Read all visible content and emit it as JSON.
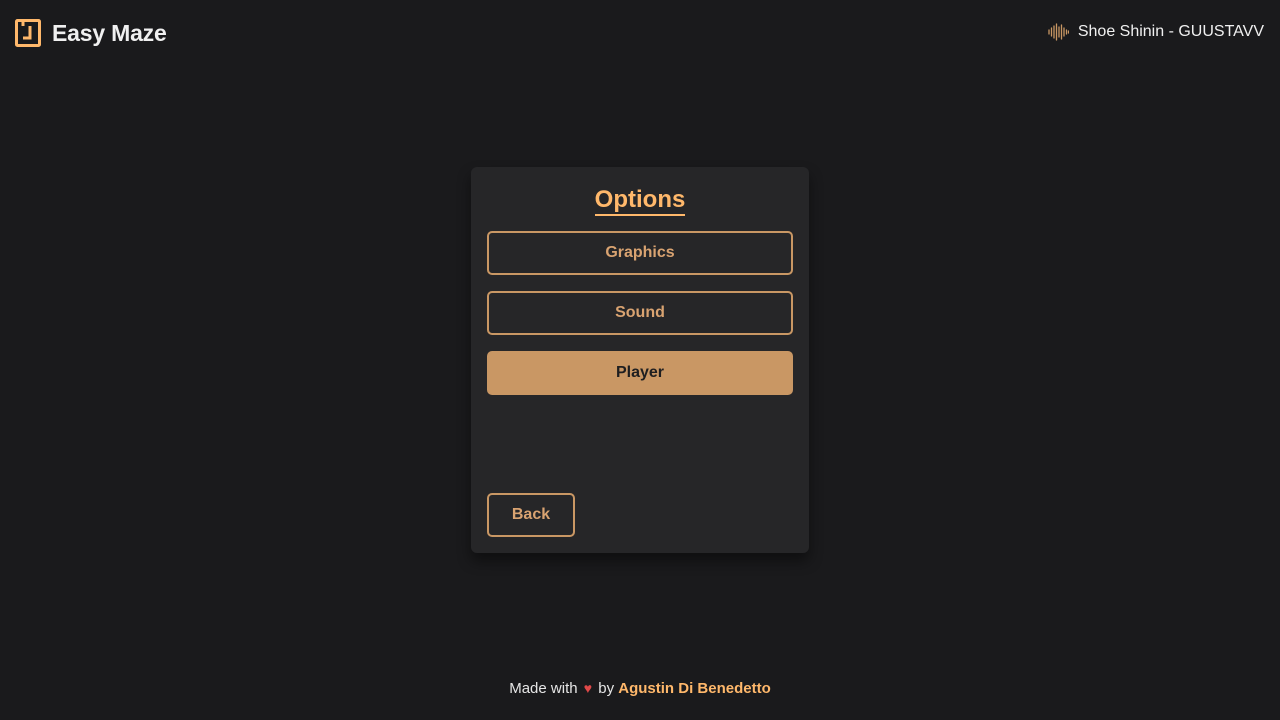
{
  "header": {
    "title": "Easy Maze",
    "logo_icon": "maze-logo-icon",
    "now_playing": {
      "icon": "sound-wave-icon",
      "track": "Shoe Shinin - GUUSTAVV"
    }
  },
  "options_menu": {
    "title": "Options",
    "items": [
      {
        "label": "Graphics",
        "selected": false
      },
      {
        "label": "Sound",
        "selected": false
      },
      {
        "label": "Player",
        "selected": true
      }
    ],
    "back_label": "Back"
  },
  "footer": {
    "prefix": "Made with",
    "heart": "♥",
    "by": "by",
    "author": "Agustin Di Benedetto"
  },
  "colors": {
    "background": "#1a1a1c",
    "card": "#262628",
    "accent": "#ffb86b",
    "button": "#c99764",
    "heart": "#e04848"
  }
}
